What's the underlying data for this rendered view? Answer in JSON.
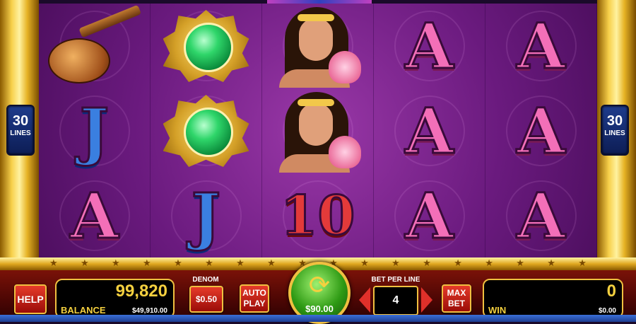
{
  "paylines": {
    "left": {
      "number": "30",
      "label": "LINES"
    },
    "right": {
      "number": "30",
      "label": "LINES"
    }
  },
  "reels": [
    [
      "sitar",
      "J",
      "A"
    ],
    [
      "emerald",
      "emerald",
      "J"
    ],
    [
      "lady",
      "lady",
      "10"
    ],
    [
      "A",
      "A",
      "A"
    ],
    [
      "A",
      "A",
      "A"
    ]
  ],
  "controls": {
    "help_label": "HELP",
    "balance": {
      "amount": "99,820",
      "label": "BALANCE",
      "cash": "$49,910.00"
    },
    "denom": {
      "title": "DENOM",
      "value": "$0.50"
    },
    "autoplay": {
      "line1": "AUTO",
      "line2": "PLAY"
    },
    "spin": {
      "icon": "spin-arrow-icon",
      "amount": "$90.00"
    },
    "bet_per_line": {
      "title": "BET PER LINE",
      "value": "4"
    },
    "max_bet": {
      "line1": "MAX",
      "line2": "BET"
    },
    "win": {
      "amount": "0",
      "label": "WIN",
      "cash": "$0.00"
    }
  },
  "colors": {
    "reel_bg": "#6a1a7e",
    "frame_gold": "#f0c040",
    "panel_red": "#7a1208",
    "letter_A": "#f36fb8",
    "letter_J": "#3a7fe0",
    "ten": "#e33a3a"
  }
}
